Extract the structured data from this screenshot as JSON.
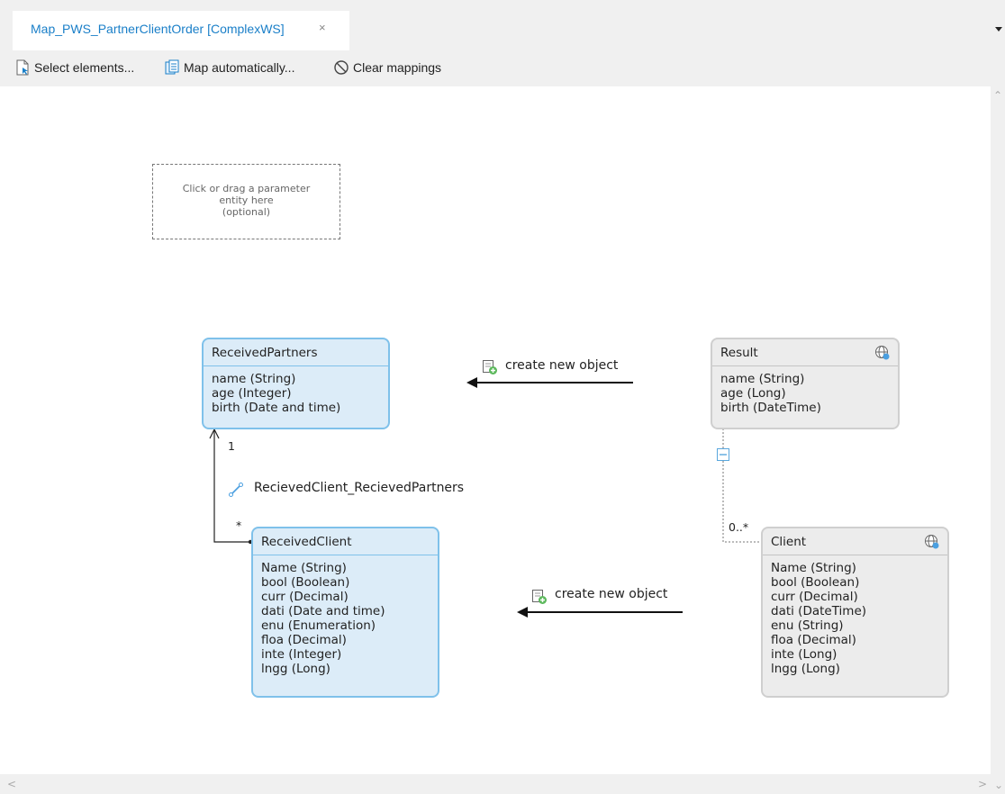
{
  "tab": {
    "title": "Map_PWS_PartnerClientOrder [ComplexWS]",
    "close": "×"
  },
  "toolbar": {
    "select_label": "Select elements...",
    "map_label": "Map automatically...",
    "clear_label": "Clear mappings"
  },
  "placeholder": {
    "line1": "Click or drag a parameter",
    "line2": "entity here",
    "line3": "(optional)"
  },
  "entities": {
    "received_partners": {
      "title": "ReceivedPartners",
      "attrs": [
        "name (String)",
        "age (Integer)",
        "birth (Date and time)"
      ]
    },
    "received_client": {
      "title": "ReceivedClient",
      "attrs": [
        "Name (String)",
        "bool (Boolean)",
        "curr (Decimal)",
        "dati (Date and time)",
        "enu (Enumeration)",
        "floa (Decimal)",
        "inte (Integer)",
        "lngg (Long)"
      ]
    },
    "result": {
      "title": "Result",
      "attrs": [
        "name (String)",
        "age (Long)",
        "birth (DateTime)"
      ]
    },
    "client": {
      "title": "Client",
      "attrs": [
        "Name (String)",
        "bool (Boolean)",
        "curr (Decimal)",
        "dati (DateTime)",
        "enu (String)",
        "floa (Decimal)",
        "inte (Long)",
        "lngg (Long)"
      ]
    }
  },
  "mapping_labels": {
    "top": "create new object",
    "bottom": "create new object"
  },
  "association": {
    "name": "RecievedClient_RecievedPartners",
    "mult_one": "1",
    "mult_many": "*"
  },
  "result_client_mult": "0..*",
  "colors": {
    "link_blue": "#1a7fc8",
    "entity_blue_bg": "#dcecf8",
    "entity_blue_border": "#7fc1ea",
    "entity_grey_bg": "#ececec",
    "entity_grey_border": "#cfcfcf"
  },
  "icons": [
    "select-elements-icon",
    "map-automatically-icon",
    "clear-mappings-icon",
    "create-object-icon",
    "association-icon",
    "globe-icon",
    "collapse-icon"
  ]
}
